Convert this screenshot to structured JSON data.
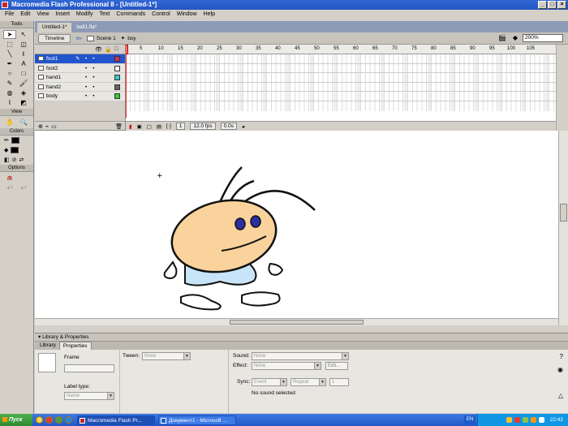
{
  "window": {
    "title": "Macromedia Flash Professional 8 - [Untitled-1*]"
  },
  "menu": [
    "File",
    "Edit",
    "View",
    "Insert",
    "Modify",
    "Text",
    "Commands",
    "Control",
    "Window",
    "Help"
  ],
  "tools": {
    "header": "Tools",
    "view_header": "View",
    "colors_header": "Colors",
    "options_header": "Options"
  },
  "doc_tabs": [
    "Untitled-1*",
    "ball1.fla*"
  ],
  "edit_bar": {
    "timeline_label": "Timeline",
    "scene_label": "Scene 1",
    "symbol_label": "boy",
    "zoom": "200%"
  },
  "layers": [
    {
      "name": "foot1",
      "color": "#cc3366",
      "selected": true
    },
    {
      "name": "foot2",
      "color": "#ffffff",
      "selected": false
    },
    {
      "name": "hand1",
      "color": "#33cccc",
      "selected": false
    },
    {
      "name": "hand2",
      "color": "#666666",
      "selected": false
    },
    {
      "name": "body",
      "color": "#33cc33",
      "selected": false
    }
  ],
  "ruler_ticks": [
    "5",
    "10",
    "15",
    "20",
    "25",
    "30",
    "35",
    "40",
    "45",
    "50",
    "55",
    "60",
    "65",
    "70",
    "75",
    "80",
    "85",
    "90",
    "95",
    "100",
    "105"
  ],
  "timeline_status": {
    "frame": "1",
    "fps": "12.0 fps",
    "time": "0.0s"
  },
  "properties_panel": {
    "header": "Library & Properties",
    "tabs": [
      "Library",
      "Properties"
    ],
    "frame_label": "Frame",
    "tween_label": "Tween:",
    "tween_value": "None",
    "sound_label": "Sound:",
    "sound_value": "None",
    "effect_label": "Effect:",
    "effect_value": "None",
    "edit_button": "Edit...",
    "label_type_label": "Label type:",
    "label_type_value": "Name",
    "sync_label": "Sync:",
    "sync_value": "Event",
    "repeat_value": "Repeat",
    "repeat_count": "1",
    "status": "No sound selected"
  },
  "taskbar": {
    "start": "Пуск",
    "tasks": [
      "Macromedia Flash Pr...",
      "Документ1 - Microsoft ..."
    ],
    "lang": "EN",
    "clock": "22:42"
  }
}
